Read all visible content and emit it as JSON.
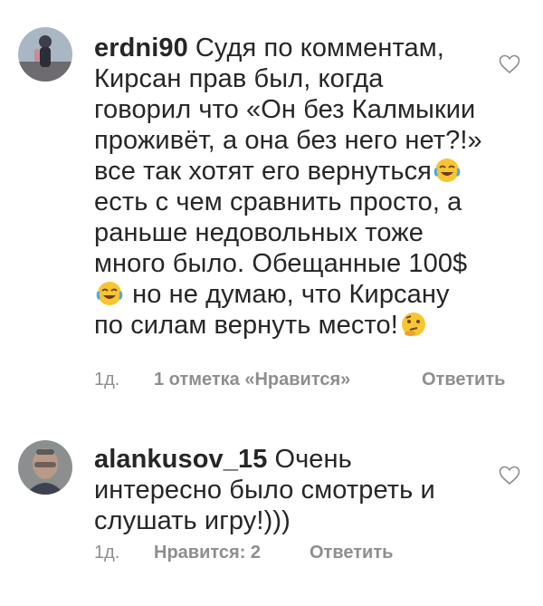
{
  "comments": [
    {
      "username": "erdni90",
      "text_parts": [
        "Судя по комментам, Кирсан прав был, когда говорил что «Он без Калмыкии проживёт, а она без него нет?!» все так хотят его вернуться",
        " есть с чем сравнить просто, а раньше недовольных тоже много было. Обещанные 100$",
        " но не думаю, что Кирсану по силам вернуть место!"
      ],
      "emojis": [
        "tears-of-joy-emoji",
        "tears-of-joy-emoji",
        "thinking-face-emoji"
      ],
      "time": "1д.",
      "likes": "1 отметка «Нравится»",
      "reply": "Ответить"
    },
    {
      "username": "alankusov_15",
      "text": "Очень интересно было смотреть и слушать игру!)))",
      "time": "1д.",
      "likes": "Нравится: 2",
      "reply": "Ответить"
    }
  ],
  "icons": {
    "like": "heart-outline-icon"
  },
  "colors": {
    "text": "#262626",
    "meta": "#8e8e8e",
    "emoji_yellow": "#f7c531"
  }
}
